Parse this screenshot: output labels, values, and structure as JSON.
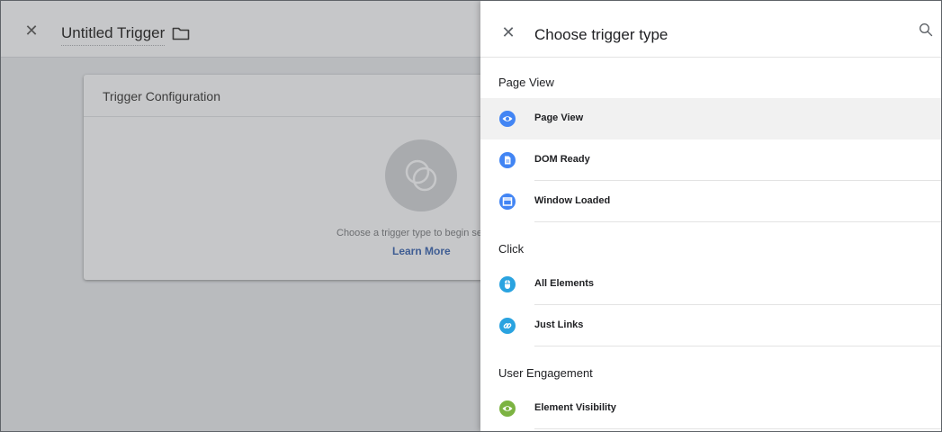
{
  "editor": {
    "title": "Untitled Trigger",
    "card": {
      "title": "Trigger Configuration",
      "hint": "Choose a trigger type to begin se",
      "learn_more": "Learn More"
    }
  },
  "panel": {
    "title": "Choose trigger type",
    "sections": [
      {
        "label": "Page View",
        "items": [
          {
            "label": "Page View",
            "icon": "eye-icon",
            "color": "#4285f4",
            "selected": true
          },
          {
            "label": "DOM Ready",
            "icon": "document-icon",
            "color": "#4285f4",
            "selected": false
          },
          {
            "label": "Window Loaded",
            "icon": "window-icon",
            "color": "#4285f4",
            "selected": false
          }
        ]
      },
      {
        "label": "Click",
        "items": [
          {
            "label": "All Elements",
            "icon": "mouse-icon",
            "color": "#2aa3e0",
            "selected": false
          },
          {
            "label": "Just Links",
            "icon": "link-icon",
            "color": "#2aa3e0",
            "selected": false
          }
        ]
      },
      {
        "label": "User Engagement",
        "items": [
          {
            "label": "Element Visibility",
            "icon": "eye-icon",
            "color": "#7cb342",
            "selected": false
          }
        ]
      }
    ]
  },
  "colors": {
    "accent_blue": "#4285f4",
    "click_blue": "#2aa3e0",
    "engagement_green": "#7cb342",
    "selected_row": "#f1f1f1"
  }
}
